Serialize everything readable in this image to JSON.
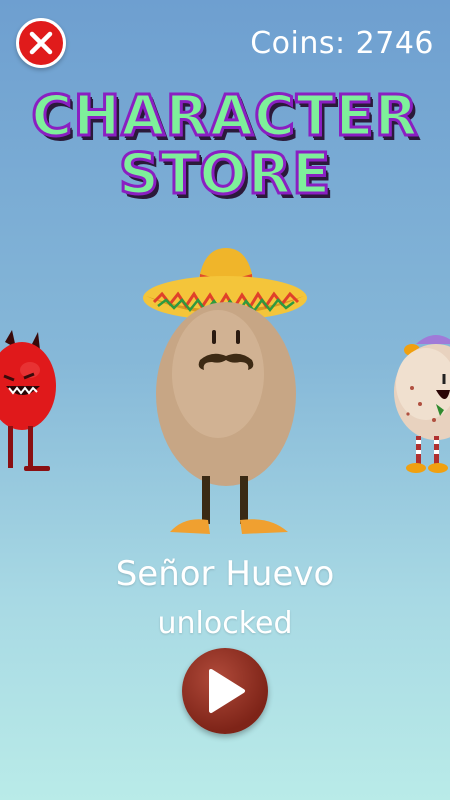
{
  "header": {
    "close_icon": "close-x-icon",
    "coins_text": "Coins: 2746"
  },
  "title": {
    "line1": "CHARACTER",
    "line2": "STORE"
  },
  "carousel": {
    "selected": {
      "name": "Señor Huevo",
      "status": "unlocked"
    },
    "neighbors": [
      "red-devil-character",
      "clown-character"
    ]
  },
  "actions": {
    "play_icon": "play-icon"
  },
  "colors": {
    "title_fill": "#7ef09a",
    "title_stroke": "#8a1fc2",
    "close_button": "#e01b1b",
    "play_button": "#7e2418"
  }
}
